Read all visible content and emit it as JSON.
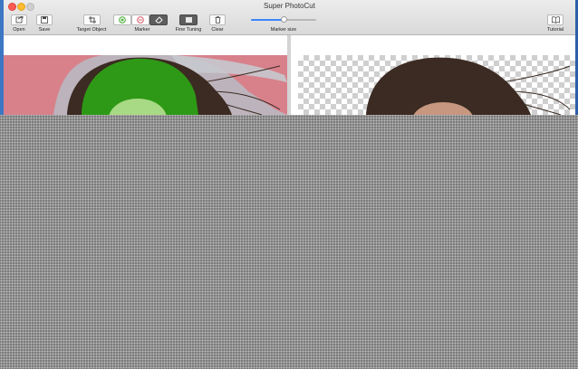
{
  "window": {
    "title": "Super PhotoCut"
  },
  "toolbar": {
    "open_label": "Open",
    "save_label": "Save",
    "target_object_label": "Target Object",
    "marker_label": "Marker",
    "fine_tuning_label": "Fine Tuning",
    "clear_label": "Clear",
    "marker_size_label": "Marker size",
    "marker_size_value": 0.5,
    "tutorial_label": "Tutorial"
  },
  "icons": {
    "open": "open-icon",
    "save": "save-icon",
    "target_object": "crop-icon",
    "marker_add": "plus-circle-icon",
    "marker_remove": "minus-circle-icon",
    "eraser": "eraser-icon",
    "fine_tuning": "fine-tuning-icon",
    "clear": "trash-icon",
    "tutorial": "book-icon"
  },
  "colors": {
    "foreground_marker": "#2ea316",
    "background_marker": "#d8818b",
    "slider_accent": "#3b86f7"
  }
}
